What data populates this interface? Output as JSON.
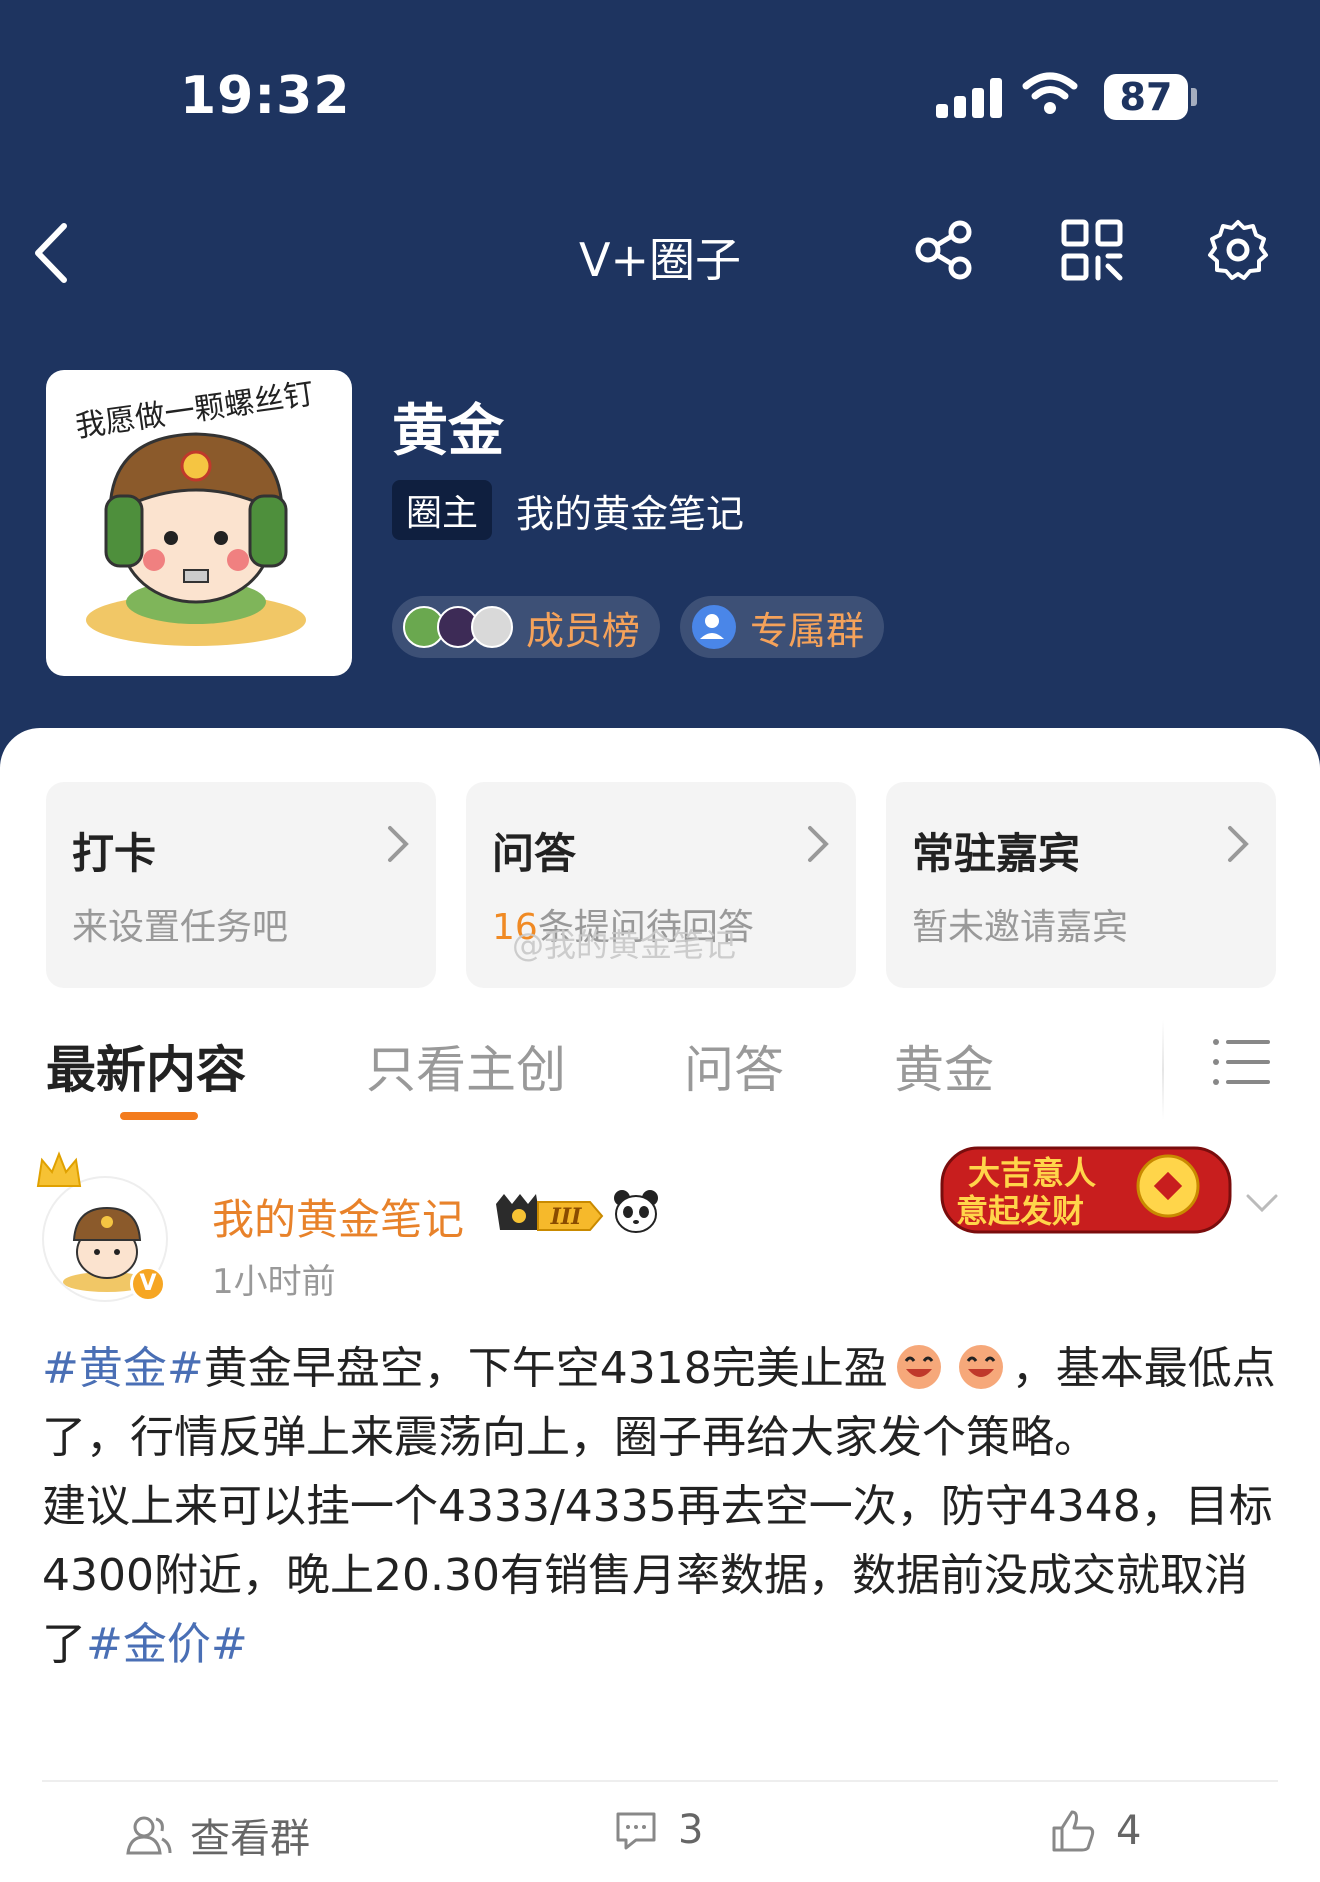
{
  "status_bar": {
    "time": "19:32",
    "battery": "87"
  },
  "navbar": {
    "title": "V+圈子",
    "icons": [
      "back-icon",
      "share-icon",
      "qr-code-icon",
      "settings-icon"
    ]
  },
  "circle": {
    "name": "黄金",
    "owner_tag": "圈主",
    "owner_name": "我的黄金笔记",
    "avatar_caption": "我愿做一颗螺丝钉",
    "member_rank_label": "成员榜",
    "group_label": "专属群"
  },
  "features": [
    {
      "title": "打卡",
      "subtitle": "来设置任务吧"
    },
    {
      "title": "问答",
      "subtitle_count": "16",
      "subtitle_rest": "条提问待回答"
    },
    {
      "title": "常驻嘉宾",
      "subtitle": "暂未邀请嘉宾"
    }
  ],
  "watermark": "@我的黄金笔记",
  "tabs": [
    "最新内容",
    "只看主创",
    "问答",
    "黄金"
  ],
  "post": {
    "author": "我的黄金笔记",
    "level_badge": "III",
    "time": "1小时前",
    "festive_banner": {
      "line1": "大吉意人",
      "line2": "意起发财"
    },
    "tag1": "#黄金#",
    "line1_text": "黄金早盘空，下午空4318完美止盈",
    "line1_tail": "，基本最低点了，行情反弹上来震荡向上，圈子再给大家发个策略。",
    "line2": "建议上来可以挂一个4333/4335再去空一次，防守4348，目标4300附近，晚上20.30有销售月率数据，数据前没成交就取消了",
    "tag2": "#金价#"
  },
  "actions": {
    "group_label": "查看群",
    "comment_count": "3",
    "like_count": "4"
  },
  "colors": {
    "header_bg": "#1e3460",
    "accent_orange": "#f37b1d",
    "topic_blue": "#4a6fb5"
  }
}
